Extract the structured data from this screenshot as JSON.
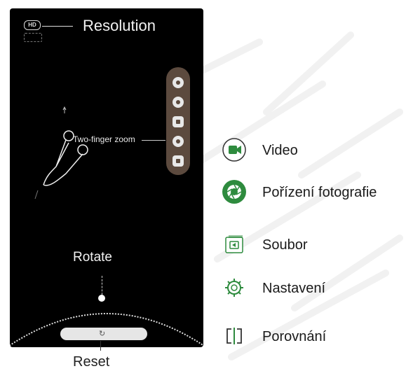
{
  "phone": {
    "hd_badge": "HD",
    "resolution_label": "Resolution",
    "zoom_label": "Two-finger zoom",
    "rotate_label": "Rotate"
  },
  "reset_label": "Reset",
  "legend": {
    "items": [
      {
        "label": "Video",
        "icon": "video-icon"
      },
      {
        "label": "Pořízení fotografie",
        "icon": "shutter-icon"
      },
      {
        "label": "Soubor",
        "icon": "file-icon"
      },
      {
        "label": "Nastavení",
        "icon": "gear-icon"
      },
      {
        "label": "Porovnání",
        "icon": "compare-icon"
      }
    ]
  },
  "colors": {
    "accent_green": "#2e8b3e",
    "toolbar_bg": "#5c4a3e",
    "screen_bg": "#000000"
  }
}
